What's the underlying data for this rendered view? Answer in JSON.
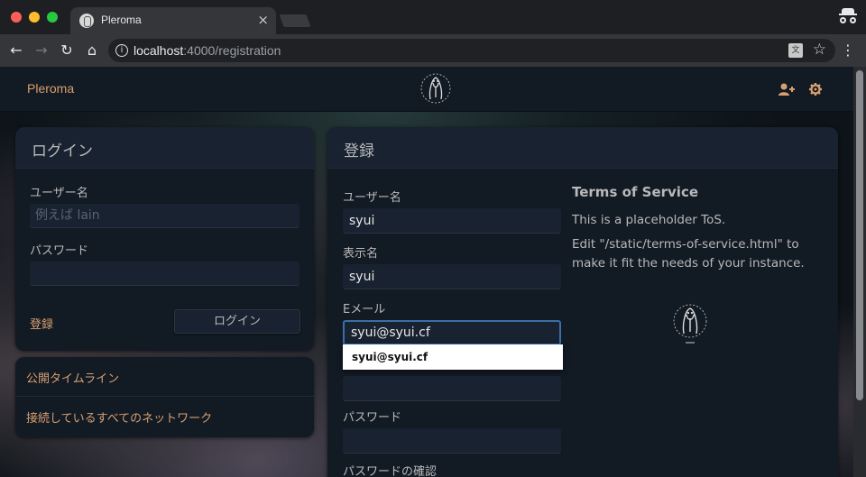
{
  "browser": {
    "tab_title": "Pleroma",
    "tab_close": "×",
    "url_host": "localhost",
    "url_path": ":4000/registration",
    "info_glyph": "i",
    "translate_glyph": "文",
    "icons": [
      "back-icon",
      "forward-icon",
      "reload-icon",
      "home-icon",
      "info-icon",
      "translate-icon",
      "star-icon",
      "menu-icon",
      "incognito-icon"
    ]
  },
  "navbar": {
    "site_name": "Pleroma",
    "icons": [
      "user-plus-icon",
      "cog-icon"
    ]
  },
  "login": {
    "heading": "ログイン",
    "username_label": "ユーザー名",
    "username_placeholder": "例えば lain",
    "password_label": "パスワード",
    "register_link": "登録",
    "login_button": "ログイン"
  },
  "timelines": {
    "public": "公開タイムライン",
    "federated": "接続しているすべてのネットワーク"
  },
  "registration": {
    "heading": "登録",
    "username_label": "ユーザー名",
    "username_value": "syui",
    "display_name_label": "表示名",
    "display_name_value": "syui",
    "email_label": "Eメール",
    "email_value": "syui@syui.cf",
    "autocomplete_option": "syui@syui.cf",
    "password_label": "パスワード",
    "password_confirm_label": "パスワードの確認"
  },
  "tos": {
    "heading": "Terms of Service",
    "p1": "This is a placeholder ToS.",
    "p2": "Edit \"/static/terms-of-service.html\" to make it fit the needs of your instance."
  },
  "colors": {
    "accent": "#d8a070",
    "panel": "#121a24",
    "input": "#182230",
    "text": "#b9b9ba"
  }
}
